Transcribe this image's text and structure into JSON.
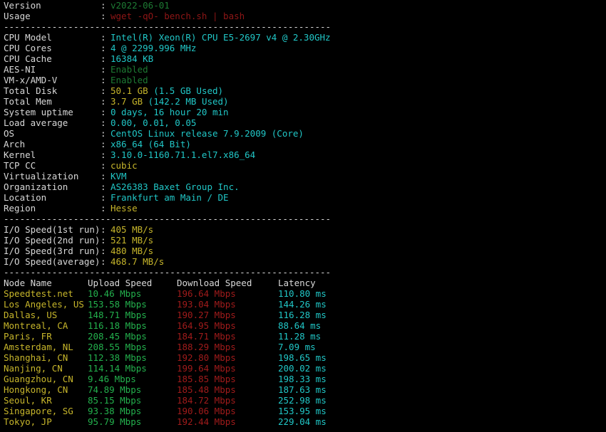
{
  "terminal": {
    "background": "#000000",
    "foreground": "#d8d8d8",
    "title": "bench.sh",
    "clipped_top_line": "v2022-06-01"
  },
  "colors": {
    "white": "#d8d8d8",
    "cyan": "#21c7c7",
    "green": "#23b14d",
    "dim_green": "#1d7a33",
    "yellow": "#c7b62b",
    "red": "#a01b1b",
    "dim_red": "#8f1616"
  },
  "separator": "-------------------------------------------------------------",
  "header": {
    "rows": [
      {
        "label": "Version",
        "value": "v2022-06-01"
      },
      {
        "label": "Usage",
        "value": "wget -qO- bench.sh | bash"
      }
    ]
  },
  "system": {
    "rows": [
      {
        "label": "CPU Model",
        "value": "Intel(R) Xeon(R) CPU E5-2697 v4 @ 2.30GHz"
      },
      {
        "label": "CPU Cores",
        "value": "4 @ 2299.996 MHz"
      },
      {
        "label": "CPU Cache",
        "value": "16384 KB"
      },
      {
        "label": "AES-NI",
        "value": "Enabled"
      },
      {
        "label": "VM-x/AMD-V",
        "value": "Enabled"
      },
      {
        "label": "Total Disk",
        "value": "50.1 GB",
        "extra": " (1.5 GB Used)"
      },
      {
        "label": "Total Mem",
        "value": "3.7 GB",
        "extra": " (142.2 MB Used)"
      },
      {
        "label": "System uptime",
        "value": "0 days, 16 hour 20 min"
      },
      {
        "label": "Load average",
        "value": "0.00, 0.01, 0.05"
      },
      {
        "label": "OS",
        "value": "CentOS Linux release 7.9.2009 (Core)"
      },
      {
        "label": "Arch",
        "value": "x86_64 (64 Bit)"
      },
      {
        "label": "Kernel",
        "value": "3.10.0-1160.71.1.el7.x86_64"
      },
      {
        "label": "TCP CC",
        "value": "cubic"
      },
      {
        "label": "Virtualization",
        "value": "KVM"
      },
      {
        "label": "Organization",
        "value": "AS26383 Baxet Group Inc."
      },
      {
        "label": "Location",
        "value": "Frankfurt am Main / DE"
      },
      {
        "label": "Region",
        "value": "Hesse"
      }
    ]
  },
  "io": {
    "rows": [
      {
        "label": "I/O Speed(1st run)",
        "value": "405 MB/s"
      },
      {
        "label": "I/O Speed(2nd run)",
        "value": "521 MB/s"
      },
      {
        "label": "I/O Speed(3rd run)",
        "value": "480 MB/s"
      },
      {
        "label": "I/O Speed(average)",
        "value": "468.7 MB/s"
      }
    ]
  },
  "speedtest": {
    "columns": [
      "Node Name",
      "Upload Speed",
      "Download Speed",
      "Latency"
    ],
    "rows": [
      {
        "node": "Speedtest.net",
        "upload": "10.46 Mbps",
        "download": "196.64 Mbps",
        "latency": "110.80 ms"
      },
      {
        "node": "Los Angeles, US",
        "upload": "153.58 Mbps",
        "download": "193.04 Mbps",
        "latency": "144.26 ms"
      },
      {
        "node": "Dallas, US",
        "upload": "148.71 Mbps",
        "download": "190.27 Mbps",
        "latency": "116.28 ms"
      },
      {
        "node": "Montreal, CA",
        "upload": "116.18 Mbps",
        "download": "164.95 Mbps",
        "latency": "88.64 ms"
      },
      {
        "node": "Paris, FR",
        "upload": "208.45 Mbps",
        "download": "184.71 Mbps",
        "latency": "11.28 ms"
      },
      {
        "node": "Amsterdam, NL",
        "upload": "208.55 Mbps",
        "download": "188.29 Mbps",
        "latency": "7.09 ms"
      },
      {
        "node": "Shanghai, CN",
        "upload": "112.38 Mbps",
        "download": "192.80 Mbps",
        "latency": "198.65 ms"
      },
      {
        "node": "Nanjing, CN",
        "upload": "114.14 Mbps",
        "download": "199.64 Mbps",
        "latency": "200.02 ms"
      },
      {
        "node": "Guangzhou, CN",
        "upload": "9.46 Mbps",
        "download": "185.85 Mbps",
        "latency": "198.33 ms"
      },
      {
        "node": "Hongkong, CN",
        "upload": "74.89 Mbps",
        "download": "185.48 Mbps",
        "latency": "187.63 ms"
      },
      {
        "node": "Seoul, KR",
        "upload": "85.15 Mbps",
        "download": "184.72 Mbps",
        "latency": "252.98 ms"
      },
      {
        "node": "Singapore, SG",
        "upload": "93.38 Mbps",
        "download": "190.06 Mbps",
        "latency": "153.95 ms"
      },
      {
        "node": "Tokyo, JP",
        "upload": "95.79 Mbps",
        "download": "192.44 Mbps",
        "latency": "229.04 ms"
      }
    ]
  }
}
